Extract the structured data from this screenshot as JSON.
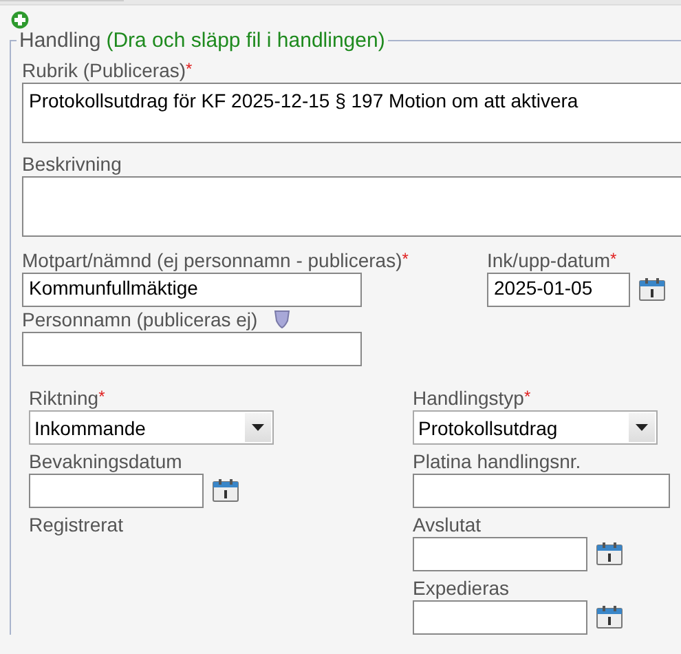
{
  "section": {
    "legend": "Handling",
    "legend_hint": "(Dra och släpp fil i handlingen)"
  },
  "top_fields": [
    {
      "kind": "area",
      "label": "Rubrik (Publiceras)",
      "required_mark": "*",
      "value": "Protokollsutdrag för KF 2025-12-15 § 197 Motion om att aktivera"
    },
    {
      "kind": "area",
      "label": "Beskrivning"
    }
  ],
  "party_fields": [
    {
      "kind": "text",
      "label": "Motpart/nämnd (ej personnamn - publiceras)",
      "required_mark": "*",
      "value": "Kommunfullmäktige"
    },
    {
      "kind": "date",
      "label": "Ink/upp-datum",
      "required_mark": "*",
      "value": "2025-01-05"
    },
    {
      "kind": "private",
      "label": "Personnamn (publiceras ej)"
    }
  ],
  "left_column": [
    {
      "kind": "select",
      "label": "Riktning",
      "required_mark": "*",
      "value": "Inkommande"
    },
    {
      "kind": "date",
      "label": "Bevakningsdatum"
    },
    {
      "kind": "label",
      "label": "Registrerat"
    }
  ],
  "right_column": [
    {
      "kind": "select",
      "label": "Handlingstyp",
      "required_mark": "*",
      "value": "Protokollsutdrag"
    },
    {
      "kind": "text",
      "label": "Platina handlingsnr."
    },
    {
      "kind": "date",
      "label": "Avslutat"
    },
    {
      "kind": "date",
      "label": "Expedieras"
    }
  ]
}
